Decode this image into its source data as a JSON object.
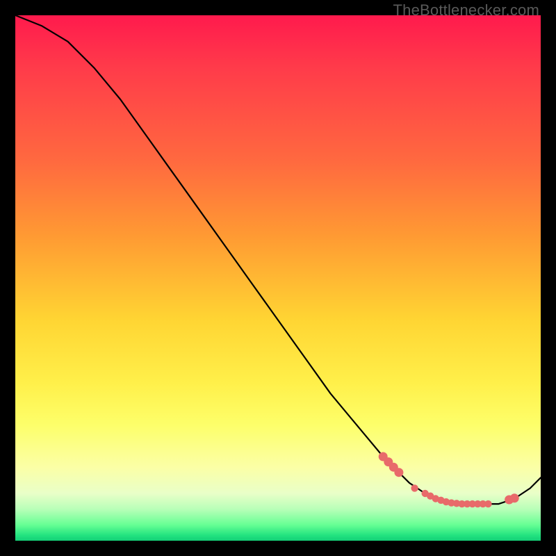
{
  "watermark": "TheBottlenecker.com",
  "colors": {
    "accent_dot": "#e86a6a",
    "curve": "#000000",
    "frame_bg": "#000000"
  },
  "chart_data": {
    "type": "line",
    "title": "",
    "xlabel": "",
    "ylabel": "",
    "xlim": [
      0,
      100
    ],
    "ylim": [
      0,
      100
    ],
    "series": [
      {
        "name": "bottleneck-curve",
        "x": [
          0,
          5,
          10,
          15,
          20,
          25,
          30,
          35,
          40,
          45,
          50,
          55,
          60,
          65,
          70,
          72,
          75,
          78,
          80,
          82,
          85,
          88,
          90,
          92,
          95,
          98,
          100
        ],
        "y": [
          100,
          98,
          95,
          90,
          84,
          77,
          70,
          63,
          56,
          49,
          42,
          35,
          28,
          22,
          16,
          14,
          11,
          9,
          8,
          7,
          7,
          7,
          7,
          7,
          8,
          10,
          12
        ]
      }
    ],
    "highlight_points": {
      "name": "optimal-zone-dots",
      "x": [
        70,
        71,
        72,
        73,
        76,
        78,
        79,
        80,
        81,
        82,
        83,
        84,
        85,
        86,
        87,
        88,
        89,
        90,
        94,
        95
      ],
      "y": [
        16,
        15,
        14,
        13,
        10,
        9,
        8.5,
        8,
        7.7,
        7.4,
        7.2,
        7.1,
        7,
        7,
        7,
        7,
        7,
        7,
        7.8,
        8.1
      ]
    }
  }
}
